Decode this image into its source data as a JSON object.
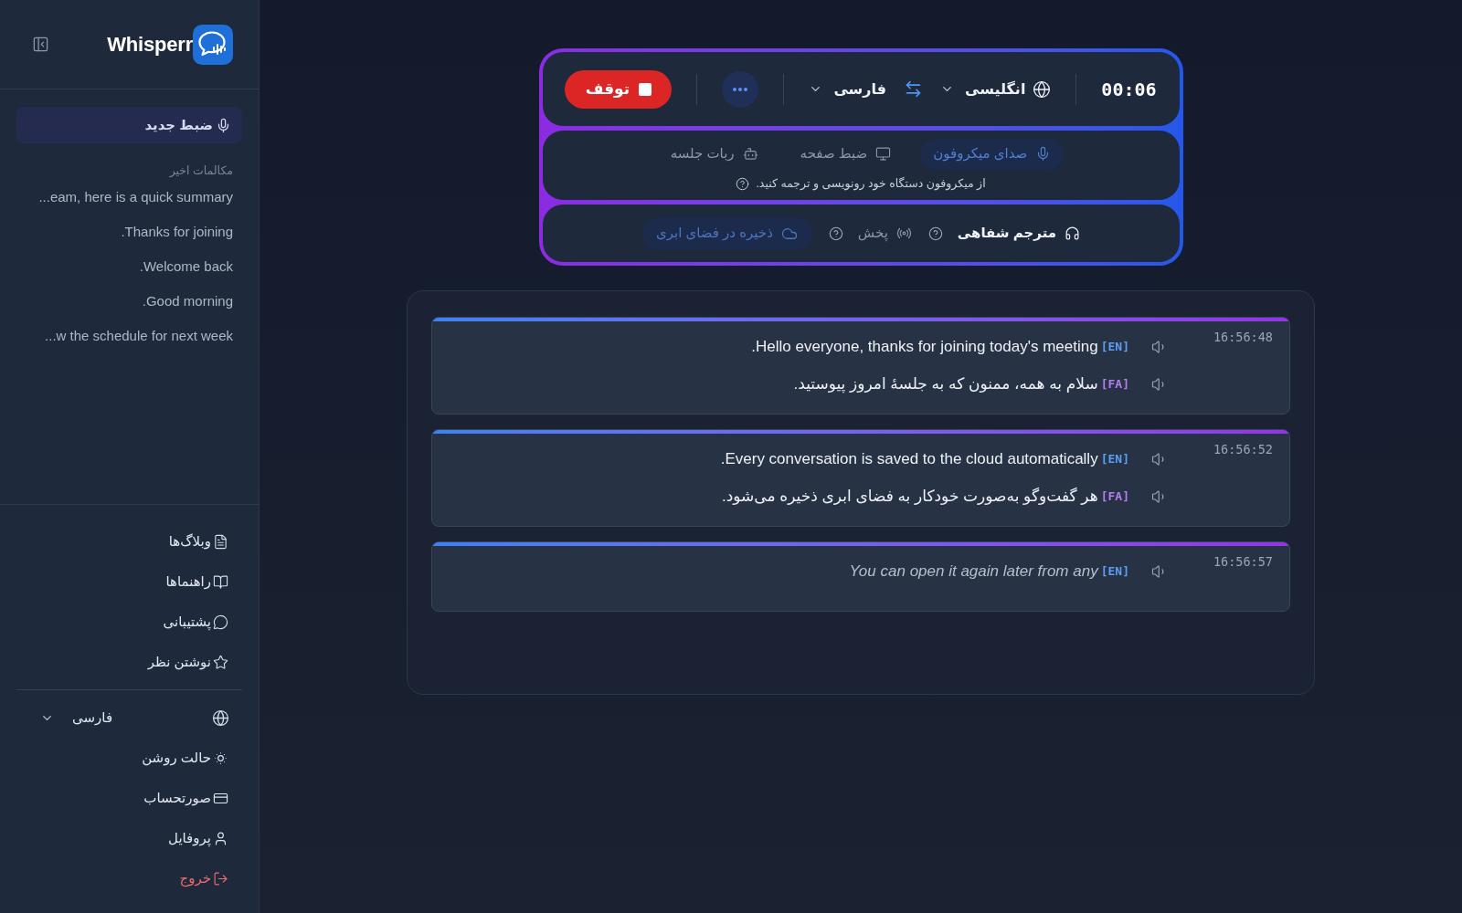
{
  "sidebar": {
    "app_name": "Whisperr",
    "new_recording": "ضبط جدید",
    "recent_heading": "مکالمات اخیر",
    "recent": [
      "...eam, here is a quick summary",
      ".Thanks for joining",
      ".Welcome back",
      ".Good morning",
      "...w the schedule for next week"
    ],
    "links": [
      "وبلاگ‌ها",
      "راهنماها",
      "پشتیبانی",
      "نوشتن نظر"
    ],
    "language": "فارسی",
    "account": [
      {
        "kind": "theme",
        "label": "حالت روشن"
      },
      {
        "kind": "billing",
        "label": "صورتحساب"
      },
      {
        "kind": "profile",
        "label": "پروفایل"
      },
      {
        "kind": "logout",
        "label": "خروج"
      }
    ]
  },
  "recorder": {
    "timer": "00:06",
    "source_language": "انگلیسی",
    "target_language": "فارسی",
    "stop_label": "توقف",
    "modes": [
      {
        "label": "صدای میکروفون",
        "selected": true
      },
      {
        "label": "ضبط صفحه",
        "selected": false
      },
      {
        "label": "ربات جلسه",
        "selected": false
      }
    ],
    "mode_hint": "از میکروفون دستگاه خود رونویسی و ترجمه کنید.",
    "options": [
      {
        "kind": "toggle",
        "label": "مترجم شفاهی",
        "on": true
      },
      {
        "kind": "toggle",
        "label": "پخش",
        "on": false
      },
      {
        "kind": "button",
        "label": "ذخیره در فضای ابری"
      }
    ]
  },
  "transcript": {
    "entries": [
      {
        "time": "16:56:48",
        "partial": false,
        "lines": [
          {
            "tag": "[EN]",
            "color": "#5b9ef4",
            "text": ".Hello everyone, thanks for joining today's meeting"
          },
          {
            "tag": "[FA]",
            "color": "#b57ef0",
            "text": "سلام به همه، ممنون که به جلسهٔ امروز پیوستید."
          }
        ]
      },
      {
        "time": "16:56:52",
        "partial": false,
        "lines": [
          {
            "tag": "[EN]",
            "color": "#5b9ef4",
            "text": ".Every conversation is saved to the cloud automatically"
          },
          {
            "tag": "[FA]",
            "color": "#b57ef0",
            "text": "هر گفت‌وگو به‌صورت خودکار به فضای ابری ذخیره می‌شود."
          }
        ]
      },
      {
        "time": "16:56:57",
        "partial": true,
        "lines": [
          {
            "tag": "[EN]",
            "color": "#5b9ef4",
            "text": "You can open it again later from any"
          }
        ]
      }
    ]
  }
}
